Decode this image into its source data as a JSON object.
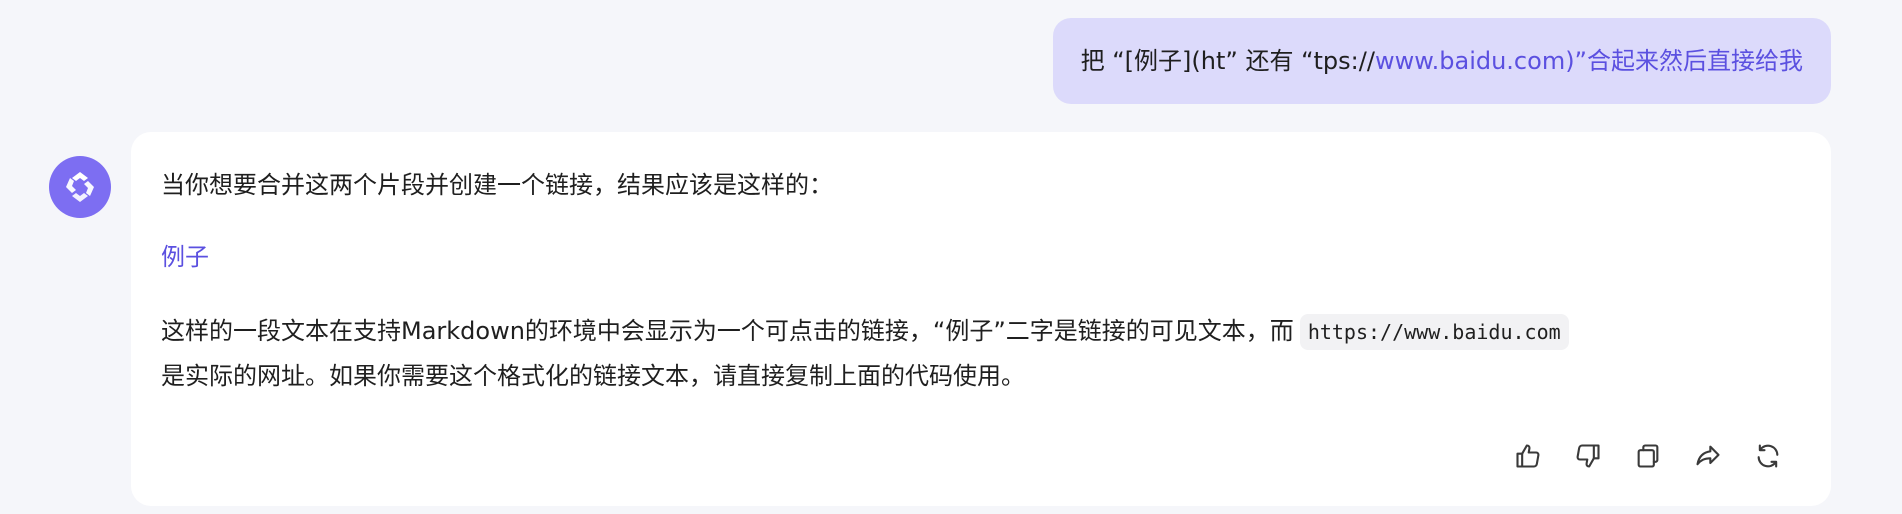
{
  "user_message": {
    "text_prefix": "把 “[例子](ht” 还有 “tps://",
    "text_link": "www.baidu.com)”合起来然后直接给我"
  },
  "assistant": {
    "intro": "当你想要合并这两个片段并创建一个链接，结果应该是这样的：",
    "link_label": "例子",
    "explanation_1": "这样的一段文本在支持Markdown的环境中会显示为一个可点击的链接，“例子”二字是链接的可见文本，而",
    "code_url": "https://www.baidu.com",
    "explanation_2": "是实际的网址。如果你需要这个格式化的链接文本，请直接复制上面的代码使用。"
  },
  "actions": [
    {
      "name": "thumbs-up-icon"
    },
    {
      "name": "thumbs-down-icon"
    },
    {
      "name": "copy-icon"
    },
    {
      "name": "share-icon"
    },
    {
      "name": "regenerate-icon"
    }
  ],
  "colors": {
    "page_bg": "#f5f6fa",
    "user_bubble_bg": "#dcdafb",
    "link": "#5b50e0",
    "avatar_bg": "#7d6ef2",
    "card_bg": "#ffffff"
  }
}
